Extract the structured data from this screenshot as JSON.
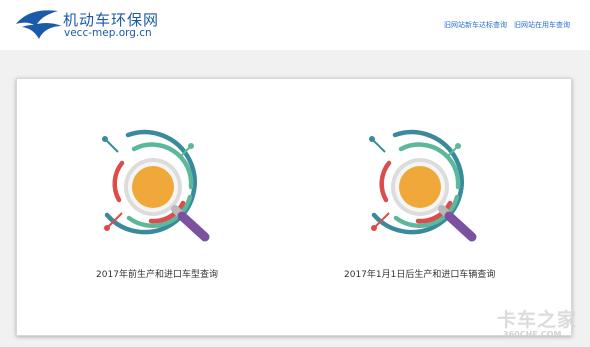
{
  "header": {
    "site_name": "机动车环保网",
    "site_domain": "vecc-mep.org.cn",
    "nav": {
      "old_new_vehicle_query": "旧网站新车达标查询",
      "old_in_use_vehicle_query": "旧网站在用车查询"
    }
  },
  "cards": {
    "model_query_label": "2017年前生产和进口车型查询",
    "vehicle_query_label": "2017年1月1日后生产和进口车辆查询"
  },
  "watermark": {
    "main": "卡车之家",
    "sub": "360CHE.COM"
  },
  "colors": {
    "brand_blue": "#1b5aa8",
    "link_blue": "#2a6fd6",
    "ring_teal": "#3a8a9c",
    "ring_green": "#5bb89b",
    "ring_red": "#de4b4b",
    "lens_orange": "#f0a83a",
    "handle_purple": "#7a52a0"
  },
  "icons": [
    "logo-bird-icon",
    "magnifier-icon"
  ]
}
